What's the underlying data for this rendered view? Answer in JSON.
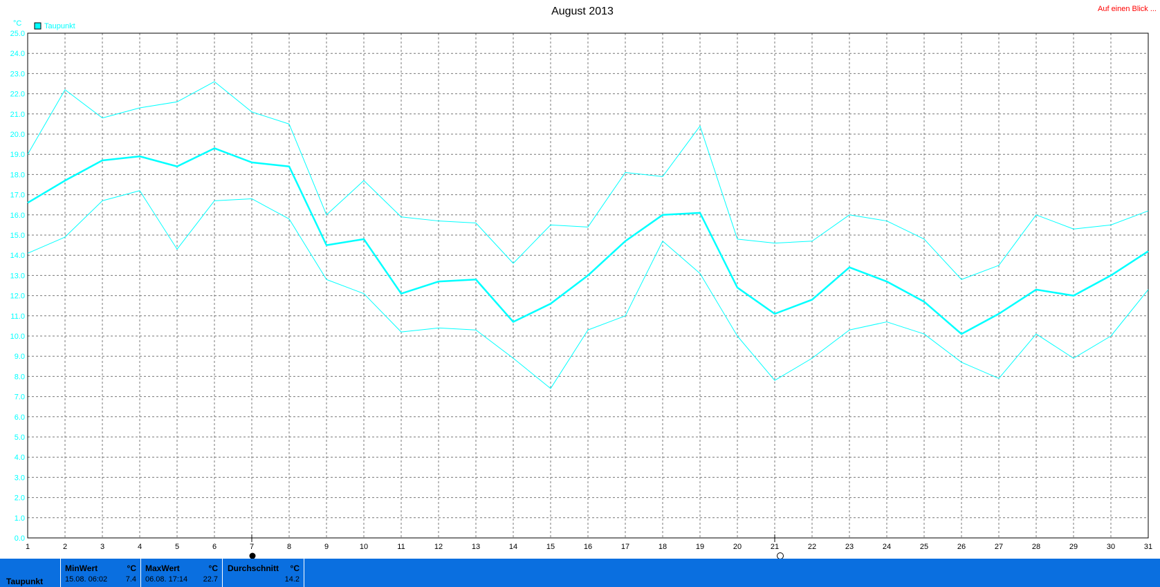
{
  "header": {
    "title": "August 2013",
    "link": "Auf einen Blick ..."
  },
  "colors": {
    "series": "#00ffff",
    "grid": "#777777",
    "bar": "#0a6fe0",
    "link": "#ff0000"
  },
  "chart_data": {
    "type": "line",
    "title": "August 2013",
    "ylabel": "°C",
    "ylim": [
      0,
      25
    ],
    "y_ticks": [
      "0.0",
      "1.0",
      "2.0",
      "3.0",
      "4.0",
      "5.0",
      "6.0",
      "7.0",
      "8.0",
      "9.0",
      "10.0",
      "11.0",
      "12.0",
      "13.0",
      "14.0",
      "15.0",
      "16.0",
      "17.0",
      "18.0",
      "19.0",
      "20.0",
      "21.0",
      "22.0",
      "23.0",
      "24.0",
      "25.0"
    ],
    "x": [
      1,
      2,
      3,
      4,
      5,
      6,
      7,
      8,
      9,
      10,
      11,
      12,
      13,
      14,
      15,
      16,
      17,
      18,
      19,
      20,
      21,
      22,
      23,
      24,
      25,
      26,
      27,
      28,
      29,
      30,
      31
    ],
    "legend": [
      "Taupunkt"
    ],
    "legend_position": "top-left",
    "grid": true,
    "series": [
      {
        "name": "Taupunkt",
        "role": "max",
        "values": [
          19.0,
          22.2,
          20.8,
          21.3,
          21.6,
          22.6,
          21.1,
          20.5,
          16.0,
          17.7,
          15.9,
          15.7,
          15.6,
          13.6,
          15.5,
          15.4,
          18.1,
          17.9,
          20.4,
          14.8,
          14.6,
          14.7,
          16.0,
          15.7,
          14.8,
          12.8,
          13.5,
          16.0,
          15.3,
          15.5,
          16.2
        ]
      },
      {
        "name": "Taupunkt",
        "role": "avg",
        "values": [
          16.6,
          17.7,
          18.7,
          18.9,
          18.4,
          19.3,
          18.6,
          18.4,
          14.5,
          14.8,
          12.1,
          12.7,
          12.8,
          10.7,
          11.6,
          13.0,
          14.7,
          16.0,
          16.1,
          12.4,
          11.1,
          11.8,
          13.4,
          12.7,
          11.7,
          10.1,
          11.1,
          12.3,
          12.0,
          13.0,
          14.2
        ]
      },
      {
        "name": "Taupunkt",
        "role": "min",
        "values": [
          14.1,
          14.9,
          16.7,
          17.2,
          14.3,
          16.7,
          16.8,
          15.8,
          12.8,
          12.1,
          10.2,
          10.4,
          10.3,
          8.9,
          7.4,
          10.3,
          11.0,
          14.7,
          13.1,
          10.0,
          7.8,
          8.9,
          10.3,
          10.7,
          10.1,
          8.7,
          7.9,
          10.1,
          8.9,
          10.0,
          12.3
        ]
      }
    ]
  },
  "stats": {
    "row_label": "Taupunkt",
    "min": {
      "label": "MinWert",
      "unit": "°C",
      "date": "15.08.  06:02",
      "value": "7.4"
    },
    "max": {
      "label": "MaxWert",
      "unit": "°C",
      "date": "06.08.  17:14",
      "value": "22.7"
    },
    "avg": {
      "label": "Durchschnitt",
      "unit": "°C",
      "value": "14.2"
    }
  }
}
